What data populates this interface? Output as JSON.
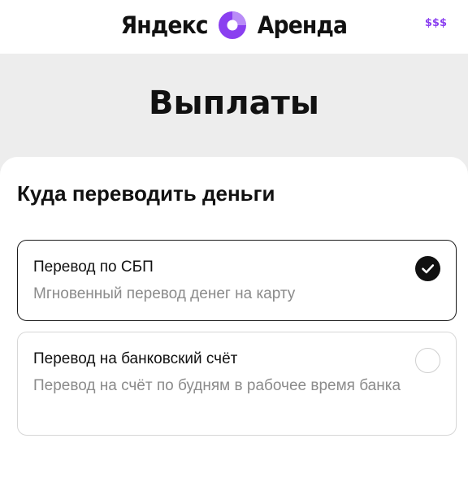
{
  "header": {
    "logo_left": "Яндекс",
    "logo_right": "Аренда",
    "logo_icon": "yandex-arenda-logo-icon",
    "badge": "$$$"
  },
  "page": {
    "title": "Выплаты"
  },
  "section": {
    "title": "Куда переводить деньги"
  },
  "options": [
    {
      "title": "Перевод по СБП",
      "description": "Мгновенный перевод денег на карту",
      "selected": true,
      "icon": "checkmark-icon"
    },
    {
      "title": "Перевод на банковский счёт",
      "description": "Перевод на счёт по будням в рабочее время банка",
      "selected": false,
      "icon": "radio-empty-icon"
    }
  ],
  "colors": {
    "brand_purple": "#8a3ff0",
    "background": "#ededed",
    "selected_border": "#1a1a1a",
    "unselected_border": "#d7d7d7",
    "secondary_text": "#8b8b8b"
  }
}
